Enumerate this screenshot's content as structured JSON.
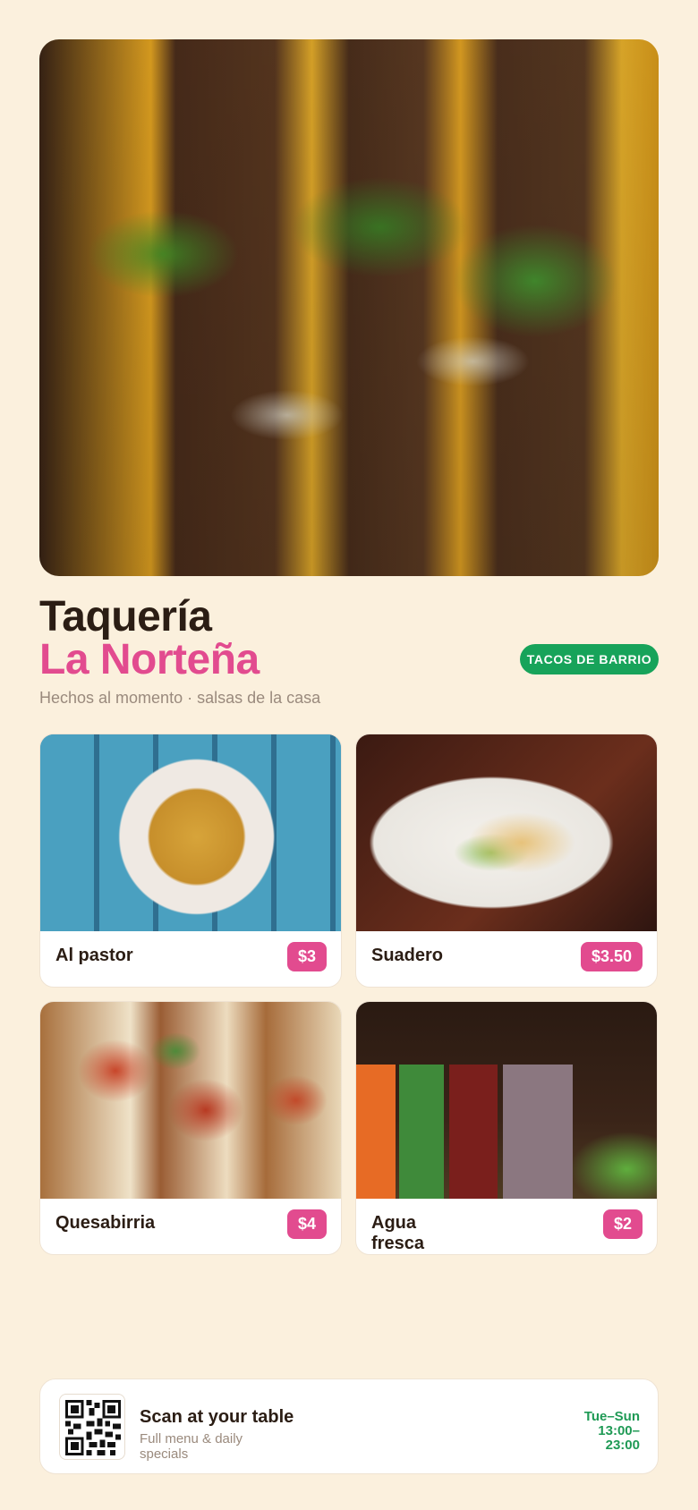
{
  "header": {
    "title_line1": "Taquería",
    "title_line2": "La Norteña",
    "tag": "TACOS DE BARRIO",
    "subtitle": "Hechos al momento · salsas de la casa"
  },
  "menu": {
    "items": [
      {
        "name": "Al pastor",
        "price": "$3"
      },
      {
        "name": "Suadero",
        "price": "$3.50"
      },
      {
        "name": "Quesabirria",
        "price": "$4"
      },
      {
        "name": "Agua fresca",
        "price": "$2"
      }
    ]
  },
  "footer": {
    "scan_title": "Scan at your table",
    "scan_subtitle": "Full menu & daily specials",
    "hours": "Tue–Sun 13:00–23:00"
  },
  "colors": {
    "background": "#fbf0dd",
    "accent_pink": "#e24b8f",
    "accent_green": "#17a35a",
    "text_dark": "#2b1d14"
  }
}
